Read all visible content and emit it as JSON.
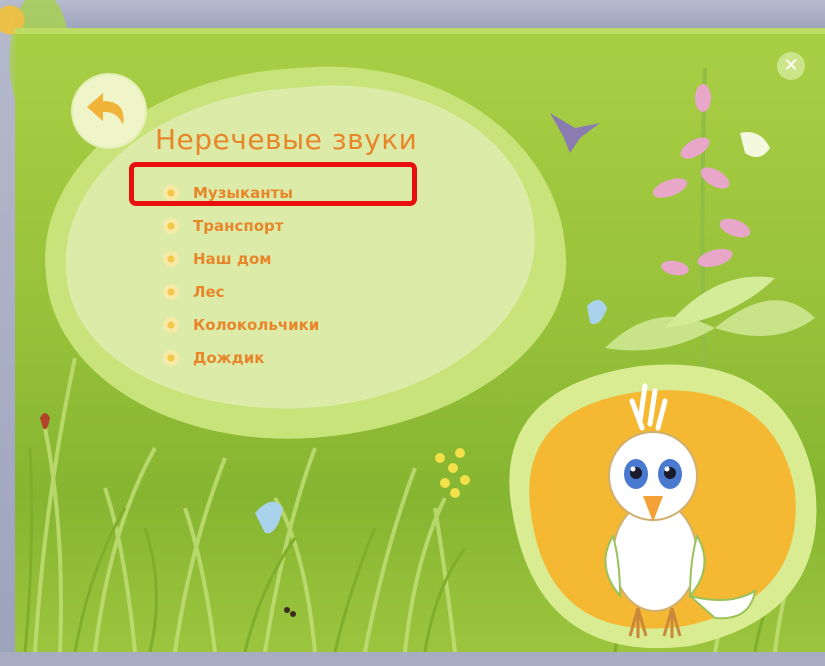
{
  "app": {
    "title": "Неречевые звуки",
    "back_icon": "back-arrow-icon",
    "close_icon": "close-icon",
    "close_glyph": "✕"
  },
  "menu": {
    "items": [
      {
        "label": "Музыканты",
        "highlighted": true
      },
      {
        "label": "Транспорт",
        "highlighted": false
      },
      {
        "label": "Наш дом",
        "highlighted": false
      },
      {
        "label": "Лес",
        "highlighted": false
      },
      {
        "label": "Колокольчики",
        "highlighted": false
      },
      {
        "label": "Дождик",
        "highlighted": false
      }
    ]
  },
  "colors": {
    "background": "#98c23a",
    "bubble": "#dceca8",
    "accent_text": "#e8862b",
    "highlight_border": "#ea0f0f",
    "bird_bubble": "#f4b833"
  },
  "decorations": {
    "character": "parrot-character",
    "icons": [
      "butterfly-icon",
      "flower-icon",
      "ant-icon",
      "snail-icon"
    ]
  }
}
